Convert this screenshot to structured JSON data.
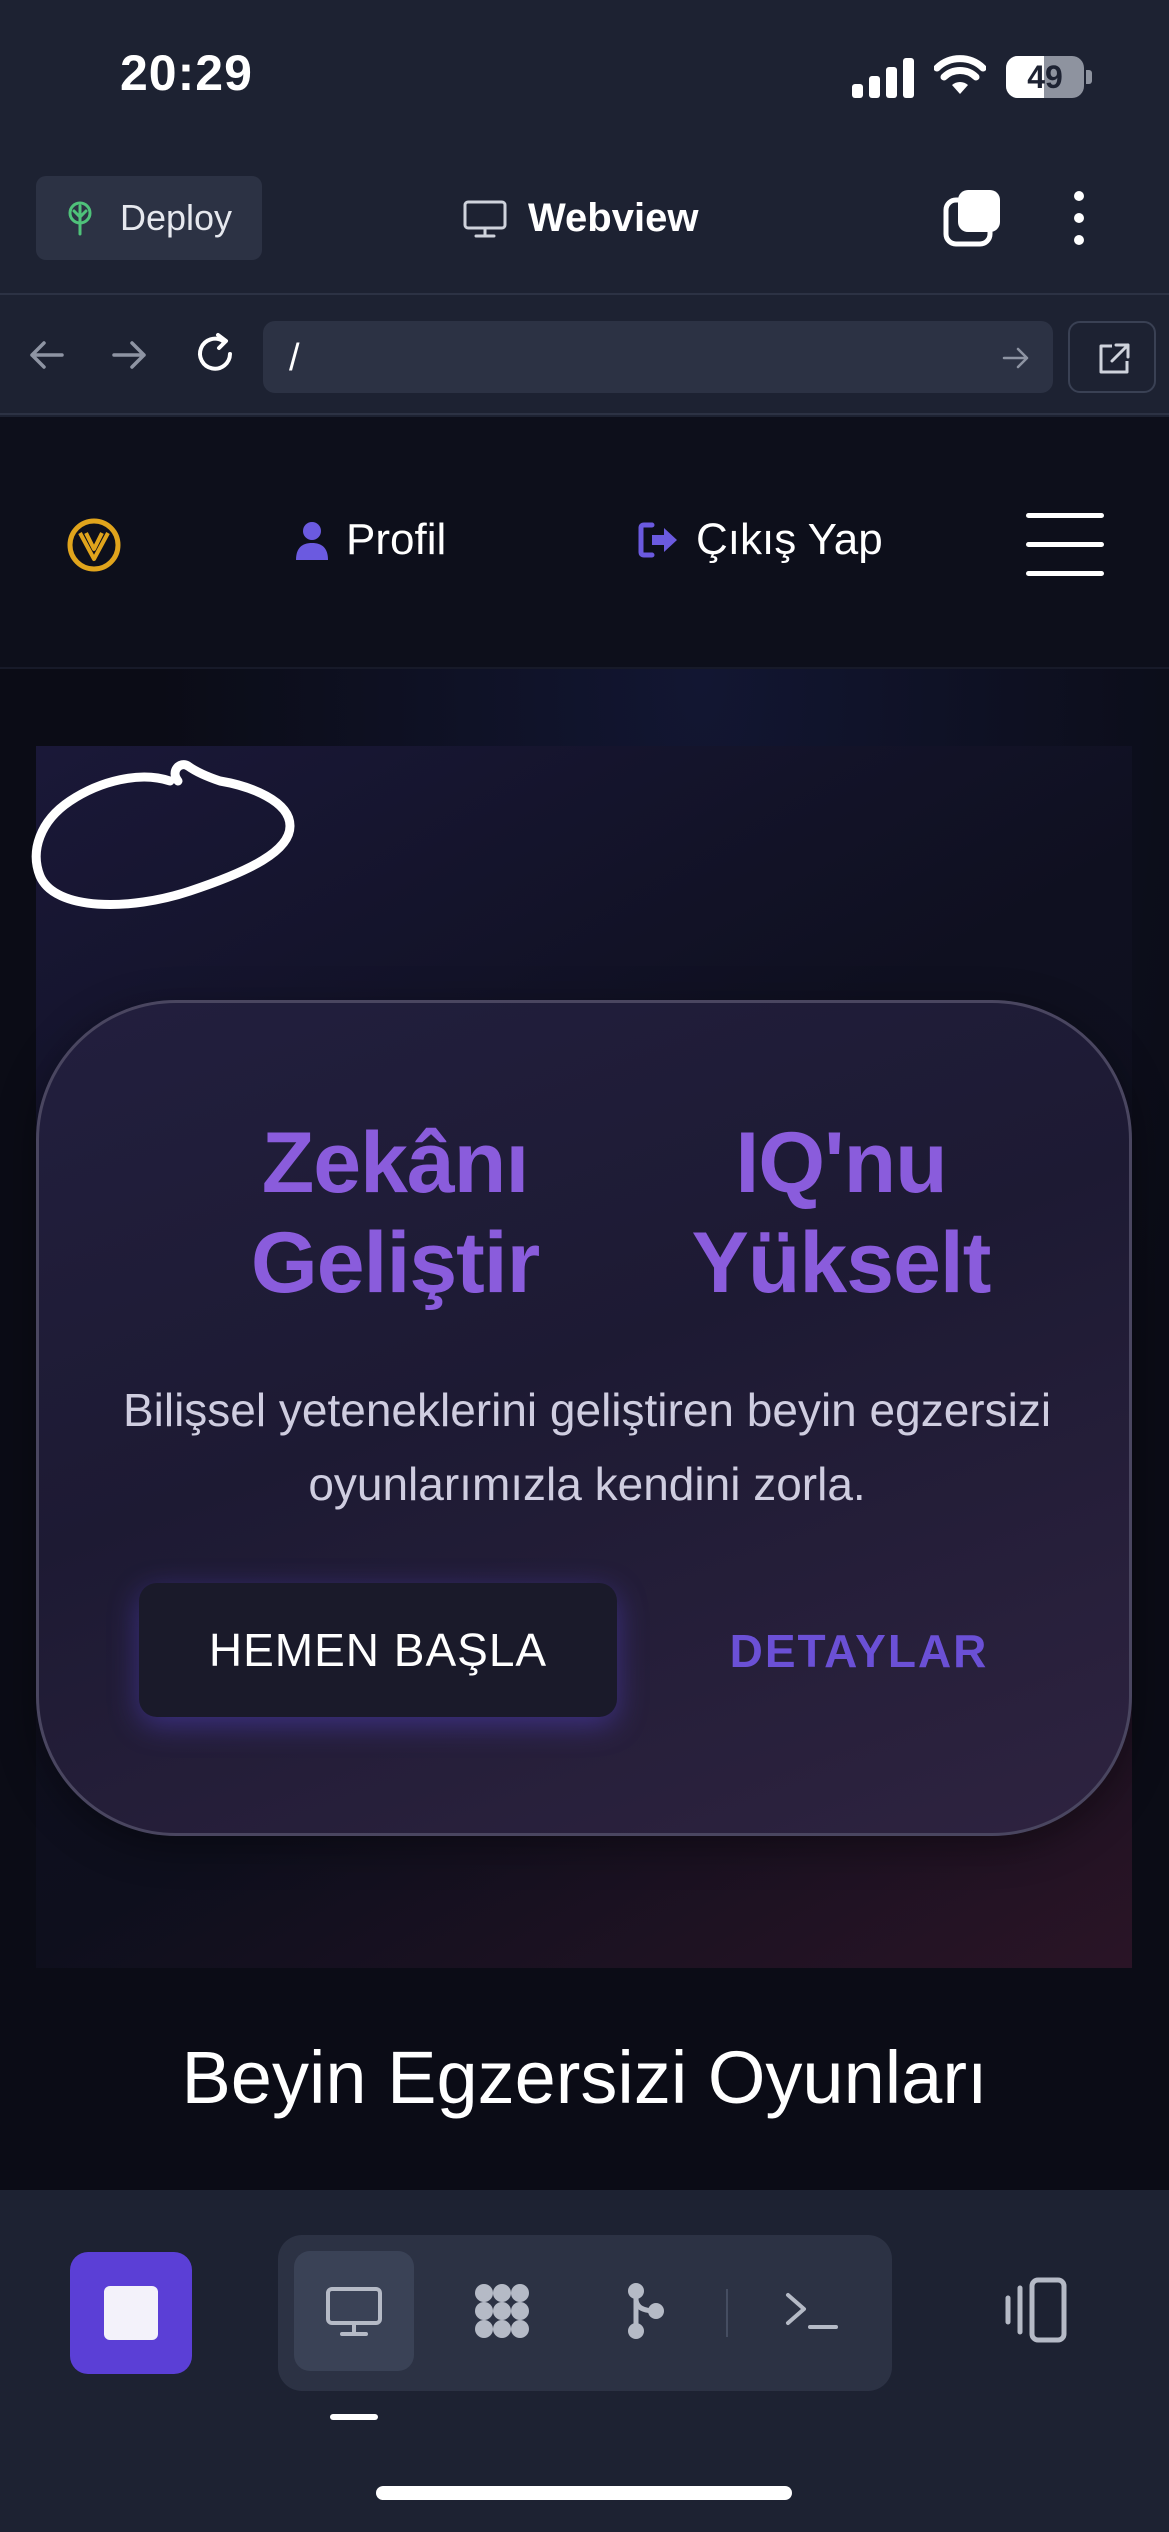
{
  "status_bar": {
    "time": "20:29",
    "battery": "49",
    "battery_level": 0.49
  },
  "header": {
    "deploy_label": "Deploy",
    "title": "Webview"
  },
  "url_bar": {
    "url": "/"
  },
  "site_nav": {
    "profile_label": "Profil",
    "logout_label": "Çıkış Yap"
  },
  "hero": {
    "heading_left": "Zekânı Geliştir",
    "heading_right": "IQ'nu Yükselt",
    "description": "Bilişsel yeteneklerini geliştiren beyin egzersizi oyunlarımızla kendini zorla.",
    "primary_button": "HEMEN BAŞLA",
    "secondary_button": "DETAYLAR"
  },
  "section": {
    "title": "Beyin Egzersizi Oyunları"
  },
  "colors": {
    "accent": "#5b3fd6",
    "heading_purple": "#8a5cdc",
    "details_purple": "#6b50d6",
    "deploy_green": "#4fc27a",
    "logo_gold": "#e0a41c"
  },
  "icons": {
    "deploy": "deploy-icon",
    "webview": "monitor-icon",
    "tabs": "tabs-icon",
    "more": "more-vertical-icon",
    "back": "arrow-left-icon",
    "forward": "arrow-right-icon",
    "reload": "reload-icon",
    "go": "arrow-right-icon",
    "external": "external-link-icon",
    "profile": "user-icon",
    "logout": "logout-icon",
    "menu": "hamburger-icon",
    "stop": "stop-icon",
    "webview_tab": "monitor-icon",
    "packages_tab": "packages-icon",
    "git_tab": "git-icon",
    "console_tab": "terminal-icon",
    "panel": "panel-icon"
  }
}
